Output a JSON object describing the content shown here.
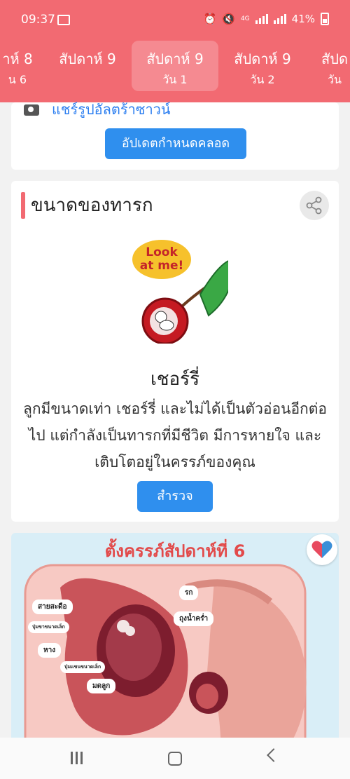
{
  "status_bar": {
    "time": "09:37",
    "battery": "41%",
    "network": "4G"
  },
  "tabs": [
    {
      "week": "าห์ 8",
      "day": "น 6"
    },
    {
      "week": "สัปดาห์ 9",
      "day": ""
    },
    {
      "week": "สัปดาห์ 9",
      "day": "วัน 1"
    },
    {
      "week": "สัปดาห์ 9",
      "day": "วัน 2"
    },
    {
      "week": "สัปด",
      "day": "วัน"
    }
  ],
  "ultrasound_card": {
    "share_text": "แชร์รูปอัลตร้าซาวน์",
    "update_button": "อัปเดตกำหนดคลอด"
  },
  "baby_size_card": {
    "title": "ขนาดของทารก",
    "badge_text": "Look at me!",
    "fruit_name": "เชอร์รี่",
    "description": "ลูกมีขนาดเท่า เชอร์รี่ และไม่ได้เป็นตัวอ่อนอีกต่อไป แต่กำลังเป็นทารกที่มีชีวิต มีการหายใจ และเติบโตอยู่ในครรภ์ของคุณ",
    "explore_button": "สำรวจ"
  },
  "pregnancy_card": {
    "title": "ตั้งครรภ์สัปดาห์ที่ 6",
    "labels": {
      "umbilical_cord": "สายสะดือ",
      "small_bud_1": "ปุ่มขาขนาดเล็ก",
      "tail": "หาง",
      "small_bud_2": "ปุ่มแขนขนาดเล็ก",
      "uterus": "มดลูก",
      "placenta": "รก",
      "amniotic_sac": "ถุงน้ำคร่ำ"
    }
  },
  "colors": {
    "brand": "#f26a72",
    "accent_button": "#2f8fee"
  }
}
